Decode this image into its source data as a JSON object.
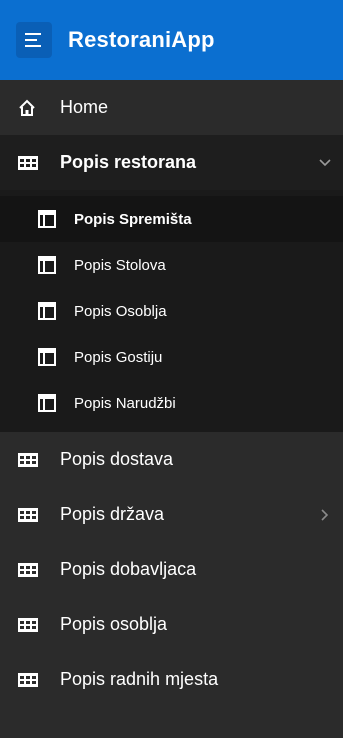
{
  "header": {
    "title": "RestoraniApp",
    "menu_icon": "menu-icon",
    "color": "#0b6fd0"
  },
  "nav": {
    "home": {
      "label": "Home",
      "icon": "home-icon"
    },
    "restaurants": {
      "label": "Popis restorana",
      "icon": "table-icon",
      "expanded": true,
      "children": [
        {
          "label": "Popis Spremišta",
          "icon": "layout-icon"
        },
        {
          "label": "Popis Stolova",
          "icon": "layout-icon"
        },
        {
          "label": "Popis Osoblja",
          "icon": "layout-icon"
        },
        {
          "label": "Popis Gostiju",
          "icon": "layout-icon"
        },
        {
          "label": "Popis Narudžbi",
          "icon": "layout-icon"
        }
      ]
    },
    "deliveries": {
      "label": "Popis dostava",
      "icon": "table-icon"
    },
    "countries": {
      "label": "Popis država",
      "icon": "table-icon",
      "has_children": true
    },
    "suppliers": {
      "label": "Popis dobavljaca",
      "icon": "table-icon"
    },
    "staff": {
      "label": "Popis osoblja",
      "icon": "table-icon"
    },
    "workplaces": {
      "label": "Popis radnih mjesta",
      "icon": "table-icon"
    }
  }
}
